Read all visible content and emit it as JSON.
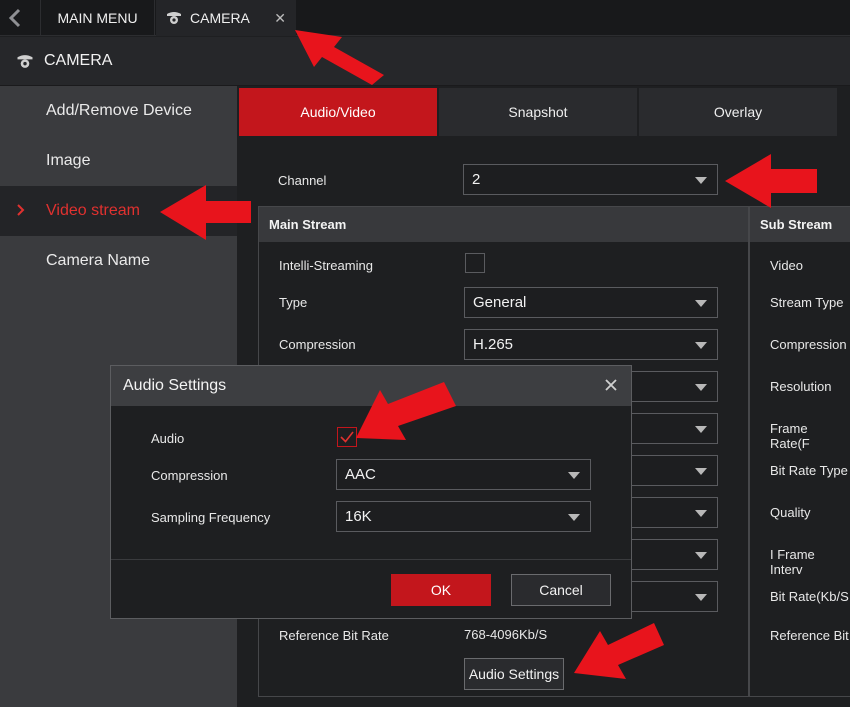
{
  "topbar": {
    "main_menu_tab": "MAIN MENU",
    "camera_tab": "CAMERA",
    "close_glyph": "✕"
  },
  "page": {
    "title": "CAMERA"
  },
  "sidebar": {
    "items": [
      {
        "label": "Add/Remove Device"
      },
      {
        "label": "Image"
      },
      {
        "label": "Video stream",
        "active": true
      },
      {
        "label": "Camera Name"
      }
    ]
  },
  "subtabs": [
    {
      "label": "Audio/Video",
      "active": true
    },
    {
      "label": "Snapshot"
    },
    {
      "label": "Overlay"
    }
  ],
  "channel": {
    "label": "Channel",
    "value": "2"
  },
  "main_stream": {
    "title": "Main Stream",
    "intelli_streaming_label": "Intelli-Streaming",
    "type_label": "Type",
    "type_value": "General",
    "compression_label": "Compression",
    "compression_value": "H.265",
    "reference_bit_rate_label": "Reference Bit Rate",
    "reference_bit_rate_value": "768-4096Kb/S",
    "audio_settings_button": "Audio Settings"
  },
  "sub_stream": {
    "title": "Sub Stream",
    "labels": [
      "Video",
      "Stream Type",
      "Compression",
      "Resolution",
      "Frame Rate(F",
      "Bit Rate Type",
      "Quality",
      "I Frame Interv",
      "Bit Rate(Kb/S",
      "Reference Bit"
    ]
  },
  "audio_dialog": {
    "title": "Audio Settings",
    "audio_label": "Audio",
    "audio_checked": true,
    "compression_label": "Compression",
    "compression_value": "AAC",
    "sampling_label": "Sampling Frequency",
    "sampling_value": "16K",
    "ok_label": "OK",
    "cancel_label": "Cancel"
  },
  "colors": {
    "accent_red": "#c3161c",
    "active_text_red": "#e0312f",
    "annotation_arrow": "#e8141c"
  }
}
